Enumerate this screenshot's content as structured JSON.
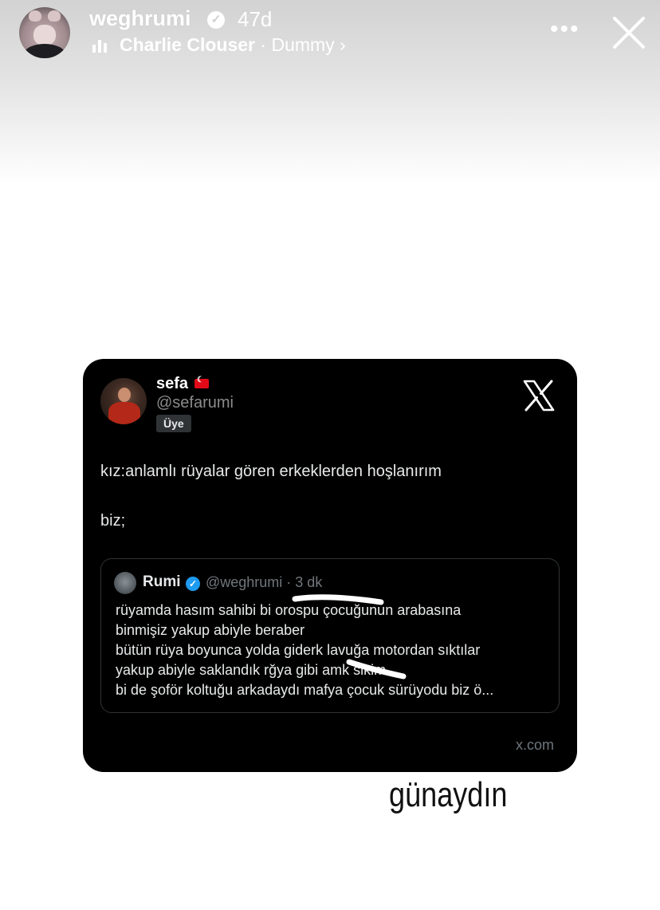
{
  "story_header": {
    "username": "weghrumi",
    "age": "47d",
    "music": {
      "artist": "Charlie Clouser",
      "separator": "·",
      "track": "Dummy",
      "chevron": "›"
    },
    "more_label": "•••"
  },
  "tweet": {
    "author_name": "sefa",
    "author_handle": "@sefarumi",
    "badge": "Üye",
    "text_line1": "kız:anlamlı rüyalar gören erkeklerden hoşlanırım",
    "text_line2": "biz;",
    "quoted": {
      "name": "Rumi",
      "meta": "@weghrumi · 3 dk",
      "lines": [
        "rüyamda hasım sahibi bi orospu çocuğunun arabasına",
        "binmişiz yakup abiyle beraber",
        "bütün rüya boyunca yolda giderk lavuğa motordan sıktılar",
        "yakup abiyle saklandık rğya gibi amk sikim",
        "bi de şoför koltuğu arkadaydı mafya çocuk sürüyodu biz ö..."
      ]
    },
    "domain": "x.com"
  },
  "caption": "günaydın",
  "colors": {
    "card_bg": "#000000",
    "verified_blue": "#1d9bf0",
    "flag_red": "#e30a17"
  },
  "icons": [
    "verified-badge-icon",
    "music-bars-icon",
    "more-icon",
    "close-icon",
    "x-logo-icon",
    "turkey-flag-icon"
  ]
}
